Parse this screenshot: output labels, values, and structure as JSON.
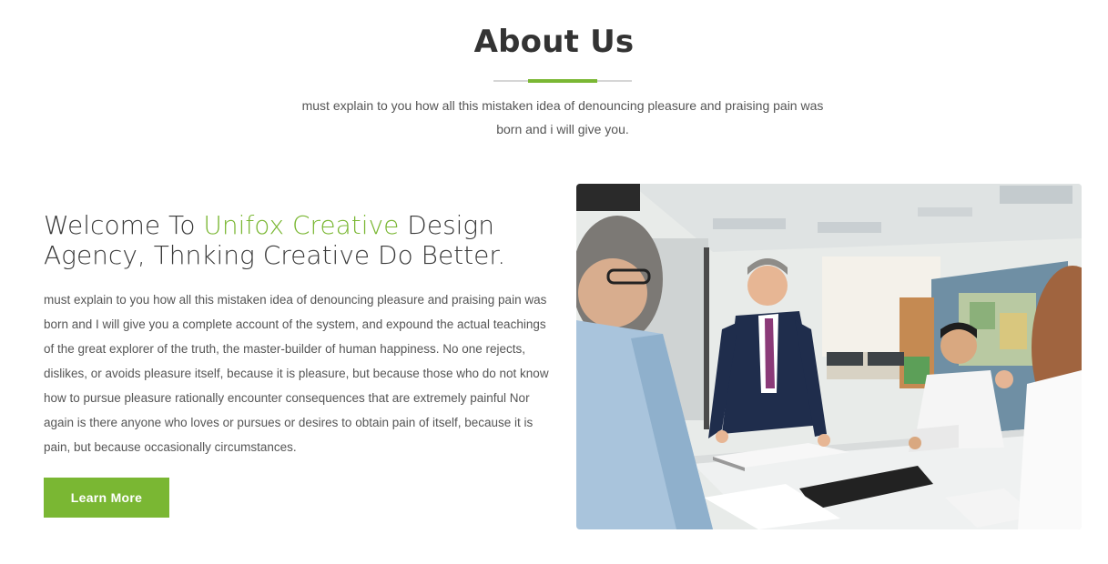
{
  "about": {
    "title": "About Us",
    "subtitle": "must explain to you how all this mistaken idea of denouncing pleasure and praising pain was born and i will give you."
  },
  "welcome": {
    "heading_pre": "Welcome To ",
    "heading_brand": "Unifox Creative",
    "heading_post": " Design Agency, Thnking Creative Do Better.",
    "body": "must explain to you how all this mistaken idea of denouncing pleasure and praising pain was born and I will give you a complete account of the system, and expound the actual teachings of the great explorer of the truth, the master-builder of human happiness. No one rejects, dislikes, or avoids pleasure itself, because it is pleasure, but because those who do not know how to pursue pleasure rationally encounter consequences that are extremely painful Nor again is there anyone who loves or pursues or desires to obtain pain of itself, because it is pain, but because occasionally circumstances.",
    "button_label": "Learn More"
  },
  "colors": {
    "accent": "#7ab733",
    "text": "#333333",
    "muted": "#555555"
  }
}
